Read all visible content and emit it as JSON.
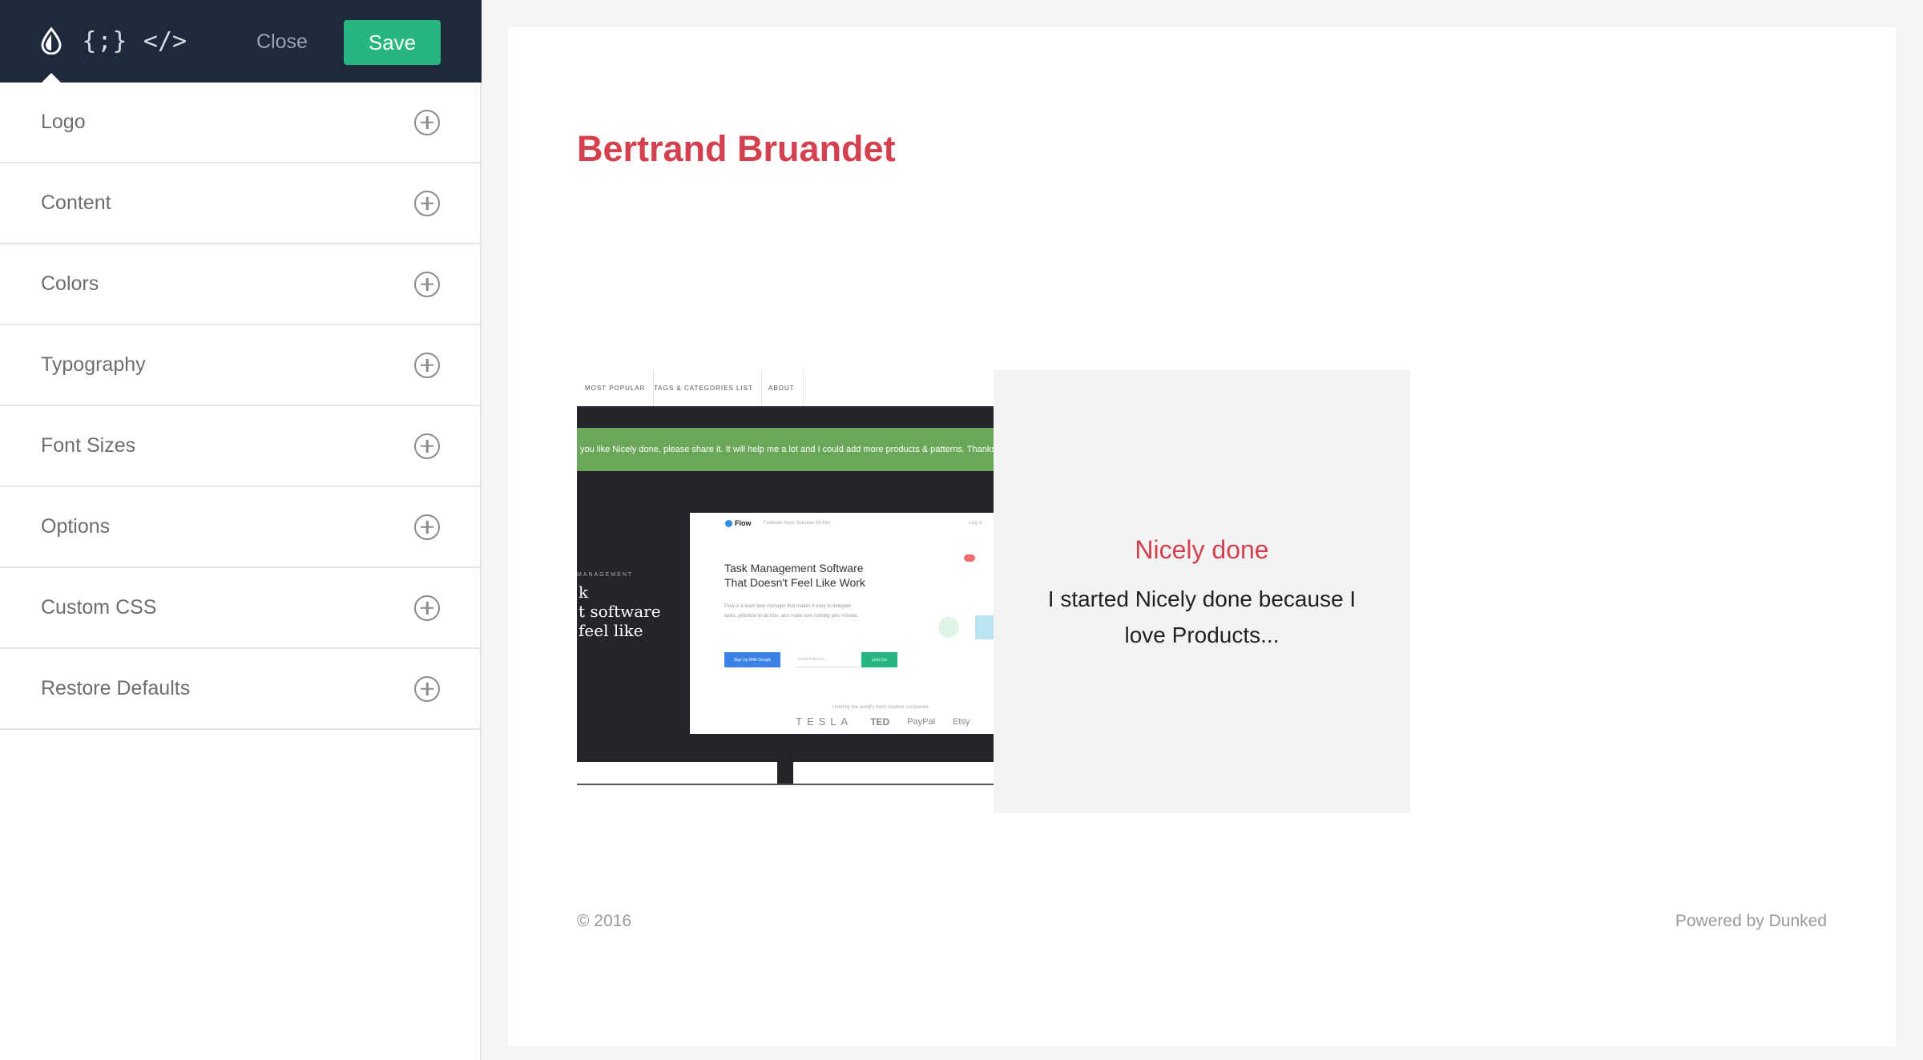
{
  "toolbar": {
    "icons": [
      "color-drop-icon",
      "variables-braces-icon",
      "code-brackets-icon"
    ],
    "variables_glyph": "{;}",
    "code_glyph": "</>",
    "close_label": "Close",
    "save_label": "Save",
    "accent_color": "#27b67f",
    "bar_color": "#1e2a3b"
  },
  "menu": {
    "items": [
      {
        "label": "Logo"
      },
      {
        "label": "Content"
      },
      {
        "label": "Colors"
      },
      {
        "label": "Typography"
      },
      {
        "label": "Font Sizes"
      },
      {
        "label": "Options"
      },
      {
        "label": "Custom CSS"
      },
      {
        "label": "Restore Defaults"
      }
    ],
    "expand_icon": "plus-circle-icon"
  },
  "preview": {
    "site_title": "Bertrand Bruandet",
    "title_color": "#d5404f",
    "project": {
      "title": "Nicely done",
      "description": "I started Nicely done because I love Products...",
      "thumbnail": {
        "nav": [
          "MOST POPULAR",
          "TAGS & CATEGORIES LIST",
          "ABOUT"
        ],
        "banner": "you like Nicely done, please share it. It will help me a lot and I could add more products & patterns. Thanks",
        "side_label": "MANAGEMENT",
        "headline_lines": [
          "k",
          "t software",
          "feel like"
        ],
        "app_logo": "Flow",
        "app_links": "Features   Apps   Success Stories",
        "app_login": "Log in",
        "app_title": "Task Management Software That Doesn't Feel Like Work",
        "app_body": "Flow is a team task manager that makes it easy to delegate tasks, prioritize to-do lists, and make sure nothing gets missed.",
        "google_button": "Sign Up With Google",
        "email_placeholder": "Email Address...",
        "get_button": "Let's Go",
        "used_by": "Used by the world's most creative companies",
        "company_logos": [
          "TESLA",
          "TED",
          "PayPal",
          "Etsy"
        ]
      }
    },
    "footer": {
      "copyright": "© 2016",
      "powered_by": "Powered by Dunked"
    }
  }
}
